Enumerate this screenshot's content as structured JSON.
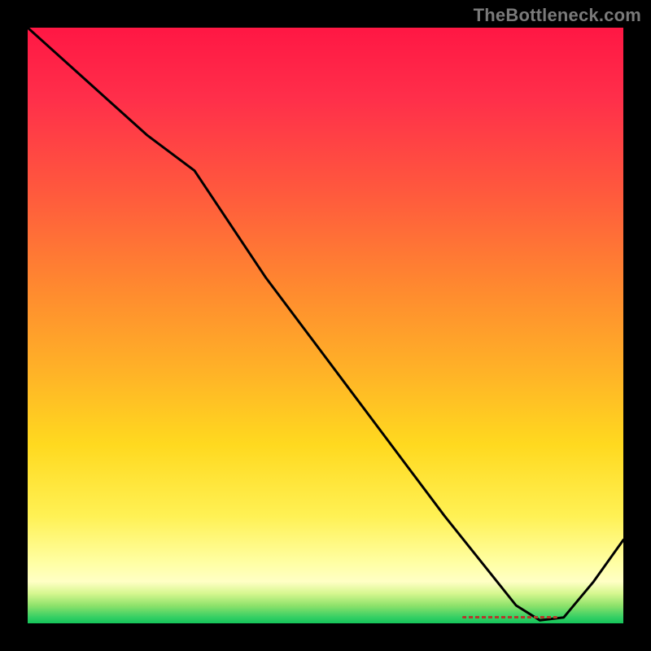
{
  "watermark": "TheBottleneck.com",
  "chart_data": {
    "type": "line",
    "title": "",
    "xlabel": "",
    "ylabel": "",
    "xlim": [
      0,
      100
    ],
    "ylim": [
      0,
      100
    ],
    "grid": false,
    "legend": false,
    "series": [
      {
        "name": "curve",
        "x": [
          0,
          10,
          20,
          28,
          40,
          55,
          70,
          78,
          82,
          86,
          90,
          95,
          100
        ],
        "y": [
          100,
          91,
          82,
          76,
          58,
          38,
          18,
          8,
          3,
          0.5,
          1,
          7,
          14
        ]
      }
    ],
    "optimal_marker": {
      "x_start": 73,
      "x_end": 89,
      "y": 1
    },
    "background_gradient": {
      "stops": [
        {
          "pos": 0,
          "color": "#ff1744"
        },
        {
          "pos": 44,
          "color": "#ff8a2f"
        },
        {
          "pos": 82,
          "color": "#fff154"
        },
        {
          "pos": 100,
          "color": "#15c45a"
        }
      ]
    }
  }
}
